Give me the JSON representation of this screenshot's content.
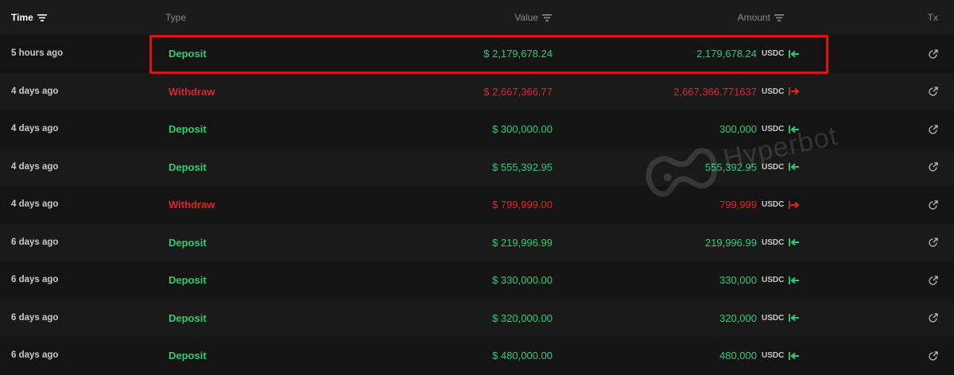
{
  "header": {
    "time": "Time",
    "type": "Type",
    "value": "Value",
    "amount": "Amount",
    "tx": "Tx"
  },
  "watermark": "Hyperbot",
  "colors": {
    "deposit": "#2ecc71",
    "withdraw": "#e02424",
    "highlight": "#e3101a"
  },
  "rows": [
    {
      "time": "5 hours ago",
      "type": "Deposit",
      "value": "$ 2,179,678.24",
      "amount": "2,179,678.24",
      "unit": "USDC",
      "direction": "in"
    },
    {
      "time": "4 days ago",
      "type": "Withdraw",
      "value": "$ 2,667,366.77",
      "amount": "2,667,366.771637",
      "unit": "USDC",
      "direction": "out"
    },
    {
      "time": "4 days ago",
      "type": "Deposit",
      "value": "$ 300,000.00",
      "amount": "300,000",
      "unit": "USDC",
      "direction": "in"
    },
    {
      "time": "4 days ago",
      "type": "Deposit",
      "value": "$ 555,392.95",
      "amount": "555,392.95",
      "unit": "USDC",
      "direction": "in"
    },
    {
      "time": "4 days ago",
      "type": "Withdraw",
      "value": "$ 799,999.00",
      "amount": "799,999",
      "unit": "USDC",
      "direction": "out"
    },
    {
      "time": "6 days ago",
      "type": "Deposit",
      "value": "$ 219,996.99",
      "amount": "219,996.99",
      "unit": "USDC",
      "direction": "in"
    },
    {
      "time": "6 days ago",
      "type": "Deposit",
      "value": "$ 330,000.00",
      "amount": "330,000",
      "unit": "USDC",
      "direction": "in"
    },
    {
      "time": "6 days ago",
      "type": "Deposit",
      "value": "$ 320,000.00",
      "amount": "320,000",
      "unit": "USDC",
      "direction": "in"
    },
    {
      "time": "6 days ago",
      "type": "Deposit",
      "value": "$ 480,000.00",
      "amount": "480,000",
      "unit": "USDC",
      "direction": "in"
    }
  ]
}
